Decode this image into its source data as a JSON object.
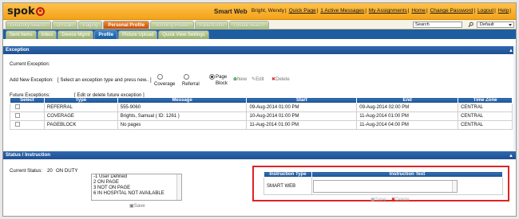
{
  "header": {
    "logo_text": "spok",
    "app_title": "Smart Web",
    "user_name": "Bright, Wendy",
    "links": [
      "Quick Page",
      "1 Active Messages",
      "My Assignments",
      "Home",
      "Change Password",
      "Logout",
      "Help"
    ]
  },
  "nav": {
    "tabs": [
      "Directory Search",
      "On Call",
      "Paging",
      "Personal Profile",
      "Scrolling Router",
      "Patient Info",
      "Global Search"
    ],
    "active_tab": "Personal Profile",
    "search_value": "Search",
    "search_mode": "Default"
  },
  "subnav": {
    "tabs": [
      "Sent Items",
      "Inbox",
      "Device Mgmt",
      "Profile",
      "Picture Upload",
      "Quick View Settings"
    ],
    "active_tab": "Profile"
  },
  "exception": {
    "title": "Exception",
    "current_label": "Current Exception:",
    "add_label": "Add New Exception:",
    "add_hint": "[ Select an exception type and press new.. ]",
    "types": [
      "Coverage",
      "Referral",
      "Page Block"
    ],
    "selected_type": "Page Block",
    "actions": [
      "New",
      "Edit",
      "Delete"
    ],
    "future_label": "Future Exceptions:",
    "future_hint": "[ Edit or delete future exception ]",
    "columns": [
      "Select",
      "Type",
      "Message",
      "Start",
      "End",
      "Time Zone"
    ],
    "rows": [
      [
        "",
        "REFERRAL",
        "555-9060",
        "09-Aug-2014 01:00 PM",
        "09-Aug-2014 02:00 PM",
        "CENTRAL"
      ],
      [
        "",
        "COVERAGE",
        "Brights, Samual ( ID: 1261 )",
        "10-Aug-2014 01:00 PM",
        "11-Aug-2014 01:00 PM",
        "CENTRAL"
      ],
      [
        "",
        "PAGEBLOCK",
        "No pages",
        "11-Aug-2014 01:00 PM",
        "11-Aug-2014 04:00 PM",
        "CENTRAL"
      ]
    ]
  },
  "status": {
    "title": "Status / Instruction",
    "current_label": "Current Status:",
    "current_code": "20",
    "current_value": "ON DUTY",
    "options": [
      "-1 User Defined",
      "2 ON PAGE",
      "3 NOT ON PAGE",
      "6 IN HOSPITAL NOT AVAILABLE"
    ],
    "save_label": "Save",
    "instruction_columns": [
      "Instruction Type",
      "Instruction Text"
    ],
    "instruction_type": "SMART WEB",
    "instruction_actions": [
      "Save",
      "Delete"
    ]
  },
  "colors": {
    "accent_orange": "#f3a21a",
    "nav_blue": "#1e5ea0",
    "highlight_red": "#e02222"
  }
}
